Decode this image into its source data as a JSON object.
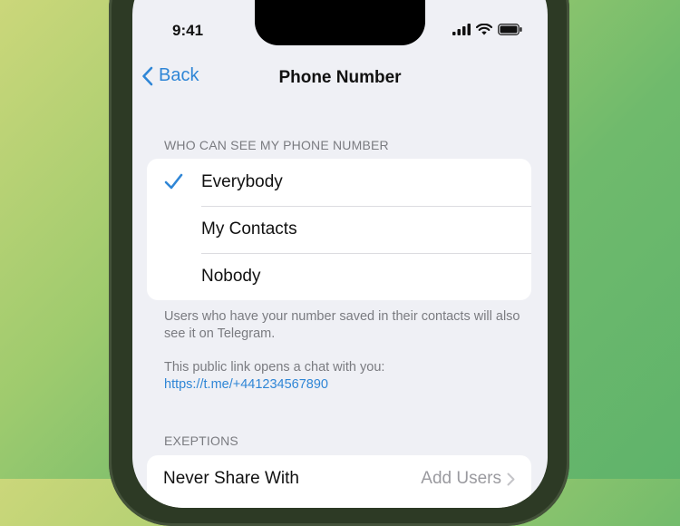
{
  "status_bar": {
    "time": "9:41"
  },
  "nav": {
    "back_label": "Back",
    "title": "Phone Number"
  },
  "visibility": {
    "header": "WHO CAN SEE MY PHONE NUMBER",
    "options": [
      {
        "label": "Everybody",
        "selected": true
      },
      {
        "label": "My Contacts",
        "selected": false
      },
      {
        "label": "Nobody",
        "selected": false
      }
    ],
    "footer_note": "Users who have your number saved in their contacts will also see it on Telegram.",
    "link_intro": "This public link opens a chat with you:",
    "link_url": "https://t.me/+441234567890"
  },
  "exceptions": {
    "header": "EXEPTIONS",
    "never_share_label": "Never Share With",
    "add_users_label": "Add Users"
  },
  "colors": {
    "accent": "#2f86d6",
    "background": "#eff0f5"
  }
}
